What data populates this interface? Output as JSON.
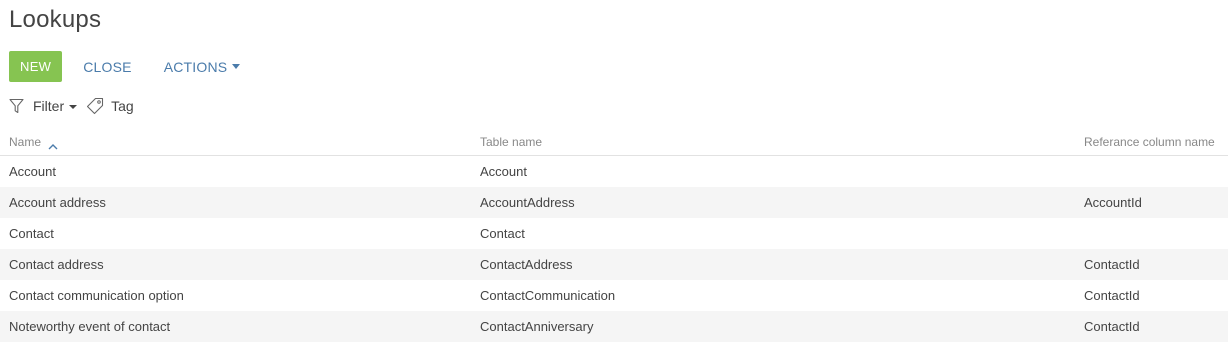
{
  "page": {
    "title": "Lookups"
  },
  "toolbar": {
    "new_label": "NEW",
    "close_label": "CLOSE",
    "actions_label": "ACTIONS"
  },
  "filterbar": {
    "filter_label": "Filter",
    "tag_label": "Tag"
  },
  "grid": {
    "columns": [
      "Name",
      "Table name",
      "Referance column name"
    ],
    "sort": {
      "column": "Name",
      "direction": "ascending"
    },
    "rows": [
      {
        "name": "Account",
        "table_name": "Account",
        "reference_column": ""
      },
      {
        "name": "Account address",
        "table_name": "AccountAddress",
        "reference_column": "AccountId"
      },
      {
        "name": "Contact",
        "table_name": "Contact",
        "reference_column": ""
      },
      {
        "name": "Contact address",
        "table_name": "ContactAddress",
        "reference_column": "ContactId"
      },
      {
        "name": "Contact communication option",
        "table_name": "ContactCommunication",
        "reference_column": "ContactId"
      },
      {
        "name": "Noteworthy event of contact",
        "table_name": "ContactAnniversary",
        "reference_column": "ContactId"
      }
    ]
  },
  "colors": {
    "new_button": "#86c451",
    "link": "#4b7cab",
    "alt_row": "#f5f5f5"
  },
  "icons": [
    "filter-icon",
    "tag-icon",
    "sort-ascending-icon",
    "chevron-down-icon"
  ]
}
